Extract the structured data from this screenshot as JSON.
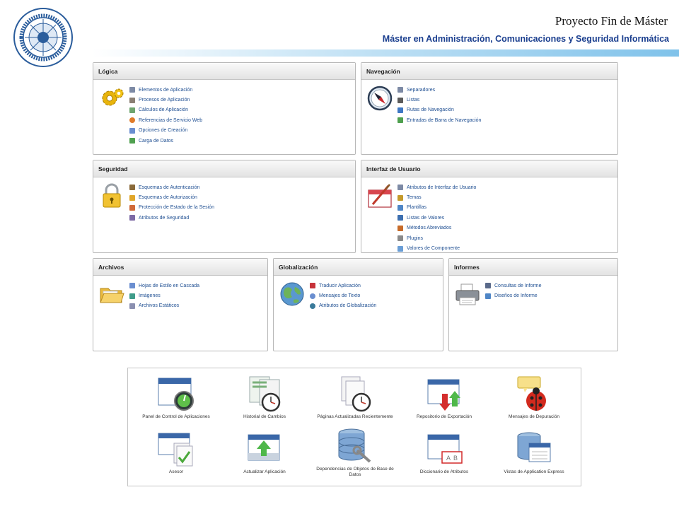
{
  "header": {
    "logo_text_top": "IN LUMINE SAPIENTIA",
    "logo_text_bottom": "UNIVERSITAS ALMERIENSIS",
    "project_title": "Proyecto Fin de Máster",
    "master_title": "Máster en Administración, Comunicaciones y Seguridad Informática"
  },
  "panels": {
    "logica": {
      "title": "Lógica",
      "items": [
        "Elementos de Aplicación",
        "Procesos de Aplicación",
        "Cálculos de Aplicación",
        "Referencias de Servicio Web",
        "Opciones de Creación",
        "Carga de Datos"
      ]
    },
    "navegacion": {
      "title": "Navegación",
      "items": [
        "Separadores",
        "Listas",
        "Rutas de Navegación",
        "Entradas de Barra de Navegación"
      ]
    },
    "seguridad": {
      "title": "Seguridad",
      "items": [
        "Esquemas de Autenticación",
        "Esquemas de Autorización",
        "Protección de Estado de la Sesión",
        "Atributos de Seguridad"
      ]
    },
    "interfaz": {
      "title": "Interfaz de Usuario",
      "items": [
        "Atributos de Interfaz de Usuario",
        "Temas",
        "Plantillas",
        "Listas de Valores",
        "Métodos Abreviados",
        "Plugins",
        "Valores de Componente"
      ]
    },
    "archivos": {
      "title": "Archivos",
      "items": [
        "Hojas de Estilo en Cascada",
        "Imágenes",
        "Archivos Estáticos"
      ]
    },
    "globalizacion": {
      "title": "Globalización",
      "items": [
        "Traducir Aplicación",
        "Mensajes de Texto",
        "Atributos de Globalización"
      ]
    },
    "informes": {
      "title": "Informes",
      "items": [
        "Consultas de Informe",
        "Diseños de Informe"
      ]
    }
  },
  "dashboard": {
    "items": [
      "Panel de Control de Aplicaciones",
      "Historial de Cambios",
      "Páginas Actualizadas Recientemente",
      "Repositorio de Exportación",
      "Mensajes de Depuración",
      "Asesor",
      "Actualizar Aplicación",
      "Dependencias de Objetos de Base de Datos",
      "Diccionario de Atributos",
      "Vistas de Application Express"
    ]
  },
  "colors": {
    "link": "#1f4f92",
    "title": "#1b3f8f",
    "header_gradient_end": "#7fc2ea"
  }
}
